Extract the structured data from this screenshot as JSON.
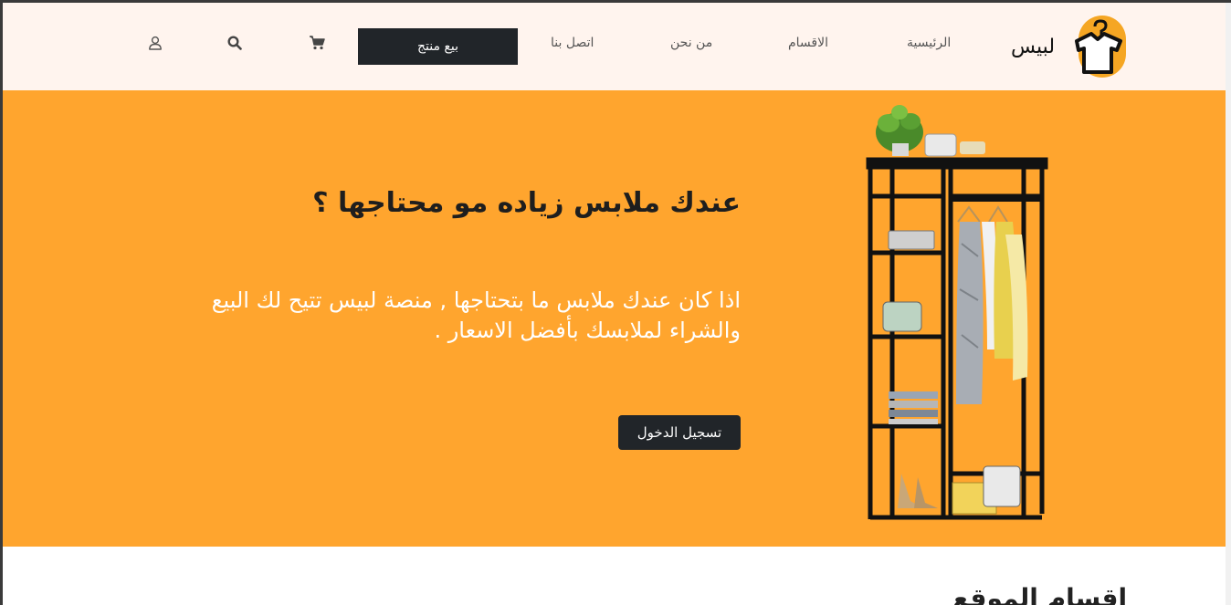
{
  "header": {
    "logo_text": "لبيس",
    "nav": {
      "home": "الرئيسية",
      "categories": "الاقسام",
      "about": "من نحن",
      "contact": "اتصل بنا"
    },
    "sell_button": "بيع منتج",
    "icons": [
      "cart-icon",
      "search-icon",
      "user-icon"
    ]
  },
  "hero": {
    "title": "عندك ملابس زياده مو محتاجها ؟",
    "description": "اذا كان عندك ملابس ما بتحتاجها , منصة لبيس تتيح لك البيع والشراء لملابسك بأفضل الاسعار .",
    "login_button": "تسجيل الدخول"
  },
  "sections": {
    "title": "اقسام الموقع"
  },
  "colors": {
    "brand_orange": "#ffa52e",
    "header_bg": "#fff4ee",
    "dark": "#212529"
  }
}
